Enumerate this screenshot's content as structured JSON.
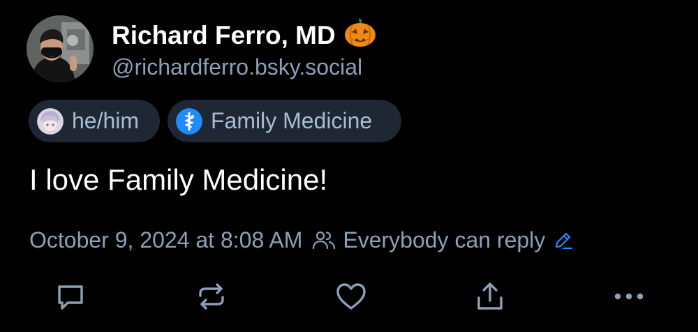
{
  "author": {
    "display_name": "Richard Ferro, MD",
    "display_name_emoji": "pumpkin-icon",
    "handle": "@richardferro.bsky.social"
  },
  "badges": [
    {
      "label": "he/him",
      "icon": "anime-avatar-icon"
    },
    {
      "label": "Family Medicine",
      "icon": "rod-of-asclepius-icon"
    }
  ],
  "post": {
    "text": "I love Family Medicine!",
    "timestamp": "October 9, 2024 at 8:08 AM",
    "reply_setting": "Everybody can reply"
  },
  "actions": [
    "reply-icon",
    "repost-icon",
    "like-icon",
    "share-icon",
    "more-icon"
  ],
  "colors": {
    "background": "#000000",
    "text_primary": "#ffffff",
    "text_secondary": "#8ca0b7",
    "badge_background": "#1e2733",
    "accent": "#208bfe"
  }
}
